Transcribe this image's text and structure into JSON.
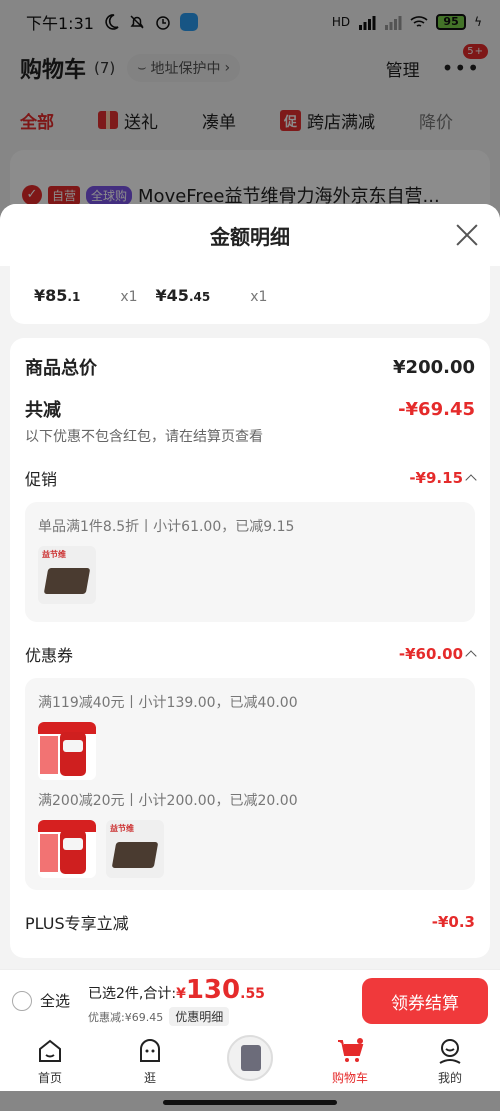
{
  "status_bar": {
    "time": "下午1:31",
    "network": "HD",
    "battery": "95"
  },
  "header": {
    "title": "购物车",
    "count": "(7)",
    "address_protect": "地址保护中",
    "manage": "管理",
    "more_badge": "5+"
  },
  "tabs": [
    {
      "label": "全部"
    },
    {
      "label": "送礼"
    },
    {
      "label": "凑单"
    },
    {
      "label": "跨店满减",
      "icon_text": "促"
    },
    {
      "label": "降价"
    }
  ],
  "store": {
    "tag_self": "自营",
    "tag_global": "全球购",
    "name": "MoveFree益节维骨力海外京东自营..."
  },
  "sheet": {
    "title": "金额明细",
    "items": [
      {
        "price_int": "¥85",
        "price_dec": ".1",
        "qty": "x1"
      },
      {
        "price_int": "¥45",
        "price_dec": ".45",
        "qty": "x1"
      }
    ],
    "total_label": "商品总价",
    "total_value": "¥200.00",
    "reduce_label": "共减",
    "reduce_value": "-¥69.45",
    "reduce_note": "以下优惠不包含红包，请在结算页查看",
    "promo": {
      "label": "促销",
      "value": "-¥9.15",
      "rules": [
        {
          "text": "单品满1件8.5折丨小计61.00，已减9.15"
        }
      ]
    },
    "coupon": {
      "label": "优惠券",
      "value": "-¥60.00",
      "rules": [
        {
          "text": "满119减40元丨小计139.00，已减40.00"
        },
        {
          "text": "满200减20元丨小计200.00，已减20.00"
        }
      ]
    },
    "plus": {
      "label": "PLUS专享立减",
      "value": "-¥0.3"
    },
    "thumb_logo": "益节维"
  },
  "checkout": {
    "select_all": "全选",
    "selected_text": "已选2件,合计:",
    "currency": "¥",
    "total_int": "130",
    "total_dec": ".55",
    "discount_text": "优惠减:¥69.45",
    "detail_pill": "优惠明细",
    "pay_button": "领券结算"
  },
  "bottom_nav": [
    {
      "label": "首页",
      "icon": "home-icon"
    },
    {
      "label": "逛",
      "icon": "browse-icon"
    },
    {
      "label": "",
      "icon": "promo-center-icon"
    },
    {
      "label": "购物车",
      "icon": "cart-icon"
    },
    {
      "label": "我的",
      "icon": "profile-icon"
    }
  ],
  "colors": {
    "accent_red": "#e52b2b",
    "pay_button": "#f0393b",
    "global_tag": "#7b55e8"
  }
}
